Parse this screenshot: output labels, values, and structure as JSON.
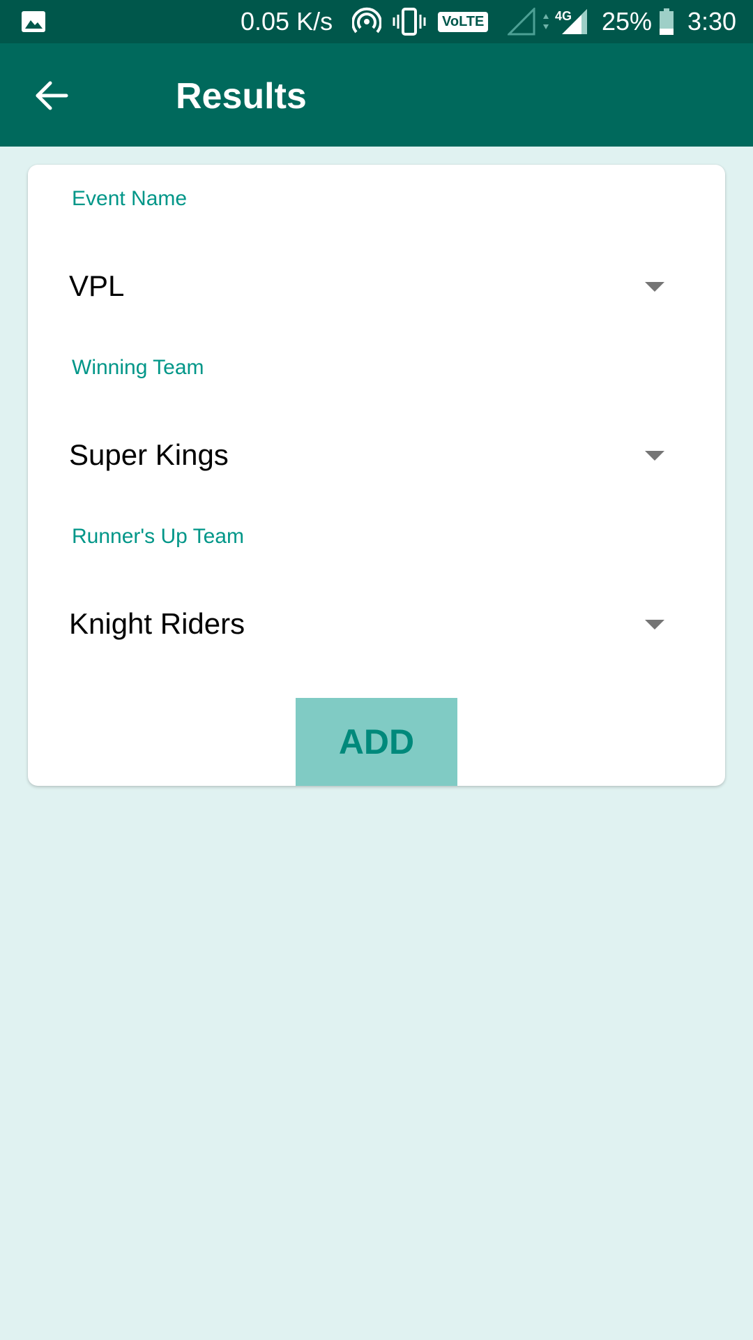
{
  "status_bar": {
    "net_speed": "0.05 K/s",
    "volte": "VoLTE",
    "network": "4G",
    "battery": "25%",
    "time": "3:30"
  },
  "app_bar": {
    "title": "Results"
  },
  "form": {
    "event_name": {
      "label": "Event Name",
      "value": "VPL"
    },
    "winning_team": {
      "label": "Winning Team",
      "value": "Super Kings"
    },
    "runner_up_team": {
      "label": "Runner's Up Team",
      "value": "Knight Riders"
    },
    "add_label": "ADD"
  },
  "colors": {
    "status_bar": "#00574B",
    "app_bar": "#00695C",
    "accent": "#009688",
    "background": "#E0F2F1",
    "button": "#80CBC4"
  }
}
